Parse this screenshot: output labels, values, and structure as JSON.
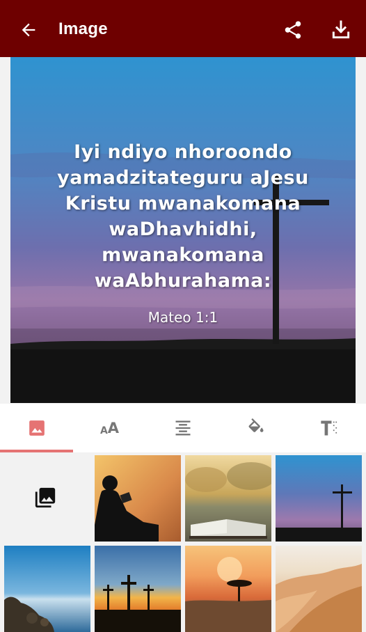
{
  "appbar": {
    "title": "Image",
    "icons": [
      "arrow-back-icon",
      "share-icon",
      "download-icon"
    ],
    "color": "#6e0000"
  },
  "preview": {
    "verse": "Iyi ndiyo nhoroondo yamadzitateguru aJesu Kristu mwanakomana waDhavhidhi, mwanakomana waAbhurahama:",
    "reference": "Mateo 1:1"
  },
  "tabs": [
    {
      "name": "background-image",
      "icon": "image-icon",
      "active": true
    },
    {
      "name": "font-size",
      "icon": "font-size-icon",
      "active": false
    },
    {
      "name": "text-align",
      "icon": "align-center-icon",
      "active": false
    },
    {
      "name": "color",
      "icon": "paint-bucket-icon",
      "active": false
    },
    {
      "name": "text-style",
      "icon": "text-format-icon",
      "active": false
    }
  ],
  "gallery": {
    "open_icon": "photo-library-icon",
    "thumbnails": [
      "boy-reading-sunset",
      "open-bible-lake",
      "cross-dusk",
      "rocky-shore-sea",
      "three-crosses-sunset",
      "savanna-tree-sunset",
      "desert-dunes"
    ]
  },
  "colors": {
    "accent": "#e57373",
    "appbar": "#6e0000"
  }
}
